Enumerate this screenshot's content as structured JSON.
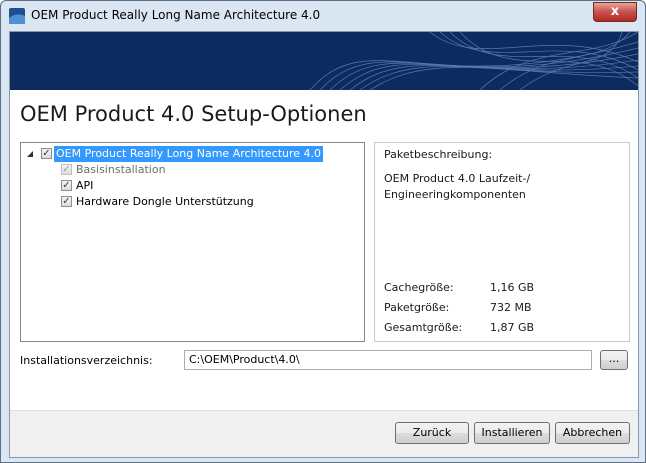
{
  "window": {
    "title": "OEM Product Really Long Name Architecture 4.0",
    "close_label": "x"
  },
  "page_title": "OEM Product 4.0 Setup-Optionen",
  "tree": {
    "root": {
      "label": "OEM Product Really Long Name Architecture 4.0",
      "checked": true,
      "selected": true
    },
    "children": [
      {
        "label": "Basisinstallation",
        "checked": true,
        "disabled": true
      },
      {
        "label": "API",
        "checked": true,
        "disabled": false
      },
      {
        "label": "Hardware Dongle Unterstützung",
        "checked": true,
        "disabled": false
      }
    ]
  },
  "description": {
    "heading": "Paketbeschreibung:",
    "line1": "OEM Product 4.0 Laufzeit-/",
    "line2": "Engineeringkomponenten",
    "sizes": [
      {
        "label": "Cachegröße:",
        "value": "1,16 GB"
      },
      {
        "label": "Paketgröße:",
        "value": "732 MB"
      },
      {
        "label": "Gesamtgröße:",
        "value": "1,87 GB"
      }
    ]
  },
  "install_dir": {
    "label": "Installationsverzeichnis:",
    "value": "C:\\OEM\\Product\\4.0\\",
    "browse_label": "..."
  },
  "buttons": {
    "back": "Zurück",
    "install": "Installieren",
    "cancel": "Abbrechen"
  },
  "colors": {
    "banner": "#0d2b5e",
    "selection": "#3399ff"
  }
}
